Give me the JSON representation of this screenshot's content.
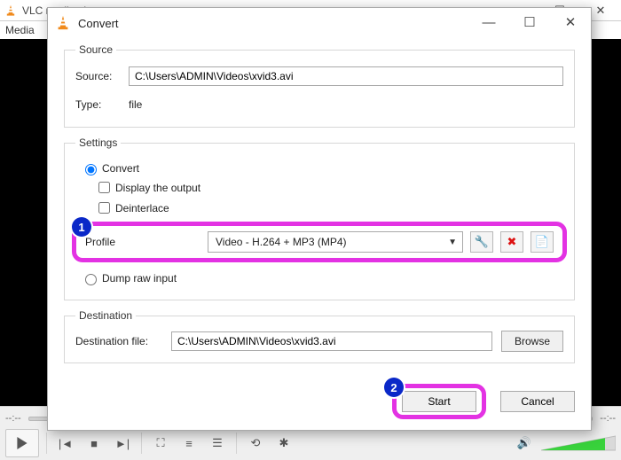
{
  "bg": {
    "title": "VLC media player",
    "menu_media": "Media",
    "time_left": "--:--",
    "time_right": "--:--"
  },
  "dialog": {
    "title": "Convert",
    "window": {
      "min": "—",
      "max": "☐",
      "close": "✕"
    }
  },
  "source": {
    "legend": "Source",
    "label": "Source:",
    "value": "C:\\Users\\ADMIN\\Videos\\xvid3.avi",
    "type_label": "Type:",
    "type_value": "file"
  },
  "settings": {
    "legend": "Settings",
    "convert": "Convert",
    "display": "Display the output",
    "deinterlace": "Deinterlace",
    "profile_label": "Profile",
    "profile_value": "Video - H.264 + MP3 (MP4)",
    "dump": "Dump raw input",
    "icons": {
      "wrench": "🔧",
      "delete": "✖",
      "new": "📄"
    },
    "badge1": "1"
  },
  "destination": {
    "legend": "Destination",
    "label": "Destination file:",
    "value": "C:\\Users\\ADMIN\\Videos\\xvid3.avi",
    "browse": "Browse"
  },
  "footer": {
    "start": "Start",
    "cancel": "Cancel",
    "badge2": "2"
  }
}
